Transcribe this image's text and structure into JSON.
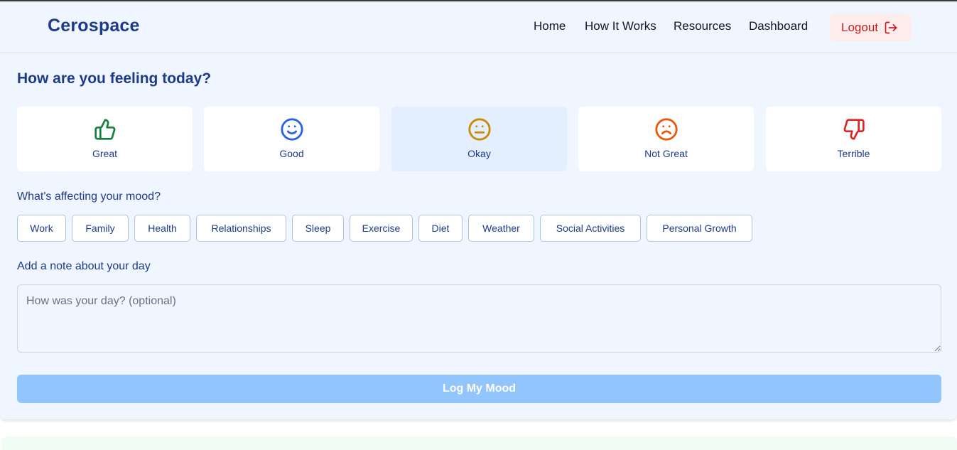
{
  "header": {
    "brand": "Cerospace",
    "nav": [
      "Home",
      "How It Works",
      "Resources",
      "Dashboard"
    ],
    "logout_label": "Logout"
  },
  "mood_section": {
    "title": "How are you feeling today?",
    "moods": [
      {
        "label": "Great",
        "icon": "thumbs-up-icon",
        "color": "#15803d"
      },
      {
        "label": "Good",
        "icon": "smile-icon",
        "color": "#2563eb"
      },
      {
        "label": "Okay",
        "icon": "neutral-face-icon",
        "color": "#ca8a04",
        "selected": true
      },
      {
        "label": "Not Great",
        "icon": "frown-icon",
        "color": "#ea580c"
      },
      {
        "label": "Terrible",
        "icon": "thumbs-down-icon",
        "color": "#dc2626"
      }
    ]
  },
  "factors": {
    "label": "What's affecting your mood?",
    "items": [
      "Work",
      "Family",
      "Health",
      "Relationships",
      "Sleep",
      "Exercise",
      "Diet",
      "Weather",
      "Social Activities",
      "Personal Growth"
    ]
  },
  "note": {
    "label": "Add a note about your day",
    "placeholder": "How was your day? (optional)",
    "value": ""
  },
  "submit_label": "Log My Mood",
  "colors": {
    "brand": "#1e3a8a",
    "background": "#eff6ff",
    "logout_text": "#c81e1e",
    "logout_bg": "#fdecec",
    "submit_bg": "#93c5fd"
  }
}
